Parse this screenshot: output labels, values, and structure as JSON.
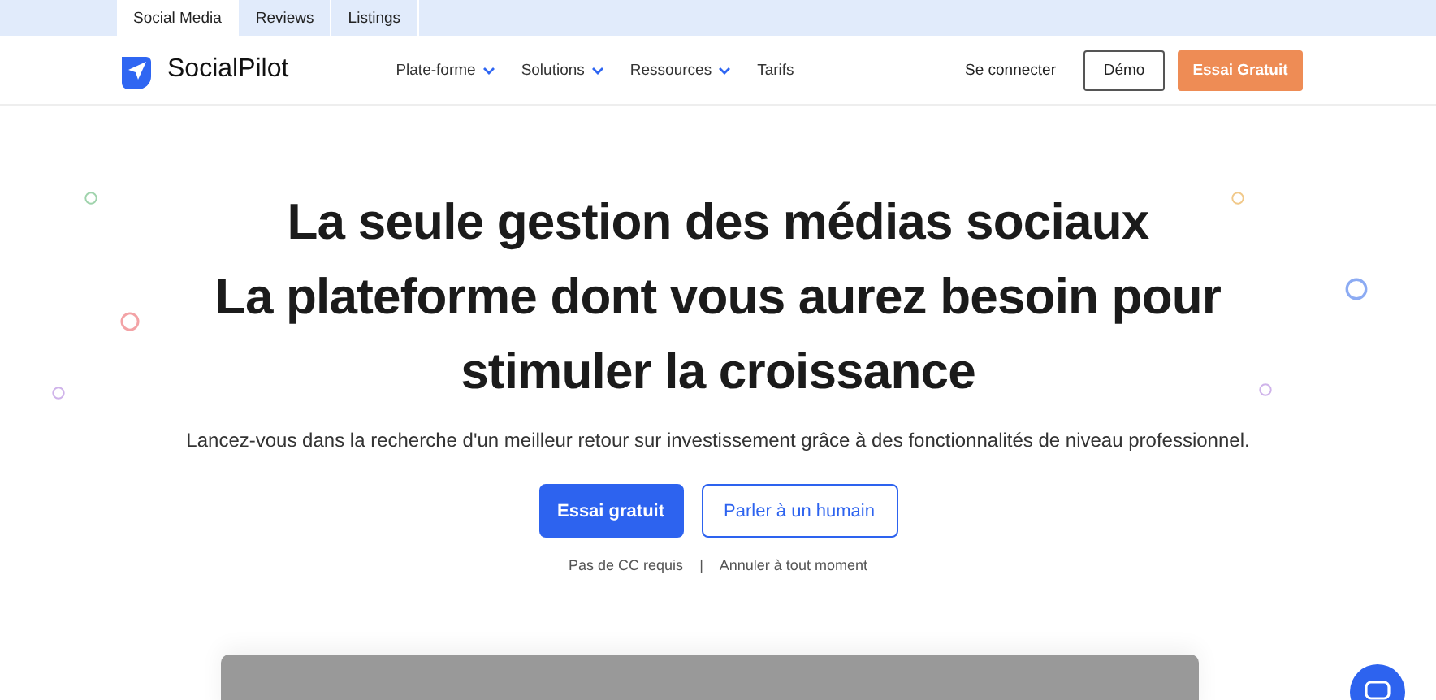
{
  "top_tabs": [
    {
      "label": "Social Media",
      "selected": true
    },
    {
      "label": "Reviews",
      "selected": false
    },
    {
      "label": "Listings",
      "selected": false
    }
  ],
  "nav": {
    "logo": "SocialPilot",
    "menu": [
      {
        "label": "Plate-forme",
        "kind": "dropdown"
      },
      {
        "label": "Solutions",
        "kind": "dropdown"
      },
      {
        "label": "Ressources",
        "kind": "dropdown"
      },
      {
        "label": "Tarifs",
        "kind": "link"
      }
    ],
    "sign_in": "Se connecter",
    "demo_button": "Démo",
    "trial_button": "Essai Gratuit"
  },
  "hero": {
    "headline": [
      "La seule gestion des médias sociaux",
      "La plateforme dont vous aurez besoin pour",
      "stimuler la croissance"
    ],
    "subtitle": "Lancez-vous dans la recherche d'un meilleur retour sur investissement grâce à des fonctionnalités de niveau professionnel.",
    "primary_button": "Essai gratuit",
    "secondary_button": "Parler à un humain",
    "notes": [
      "Pas de CC requis",
      "Annuler à tout moment"
    ],
    "separator": "|"
  }
}
